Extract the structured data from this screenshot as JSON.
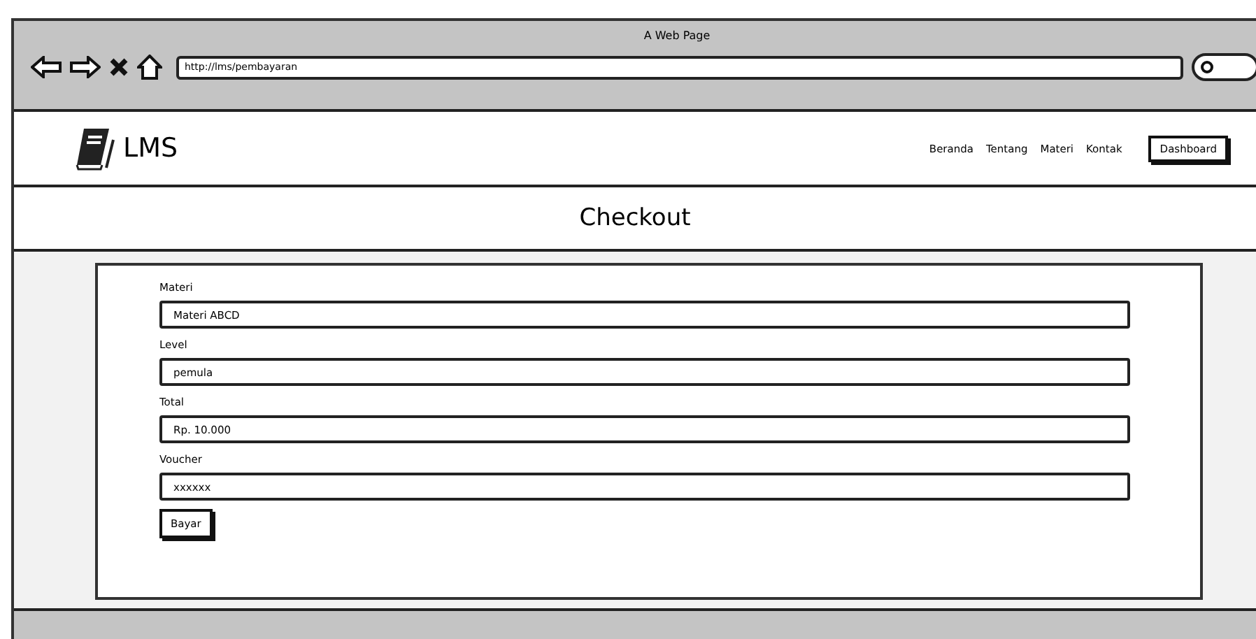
{
  "window": {
    "title": "A Web Page"
  },
  "address_bar": {
    "value": "http://lms/pembayaran"
  },
  "brand": {
    "name": "LMS"
  },
  "nav": [
    {
      "label": "Beranda",
      "kind": "link"
    },
    {
      "label": "Tentang",
      "kind": "link"
    },
    {
      "label": "Materi",
      "kind": "link"
    },
    {
      "label": "Kontak",
      "kind": "link"
    },
    {
      "label": "Dashboard",
      "kind": "button"
    }
  ],
  "page_title": "Checkout",
  "form": {
    "fields": [
      {
        "label": "Materi",
        "value": "Materi ABCD"
      },
      {
        "label": "Level",
        "value": "pemula"
      },
      {
        "label": "Total",
        "value": "Rp. 10.000"
      },
      {
        "label": "Voucher",
        "value": "xxxxxx"
      }
    ],
    "submit": "Bayar"
  }
}
